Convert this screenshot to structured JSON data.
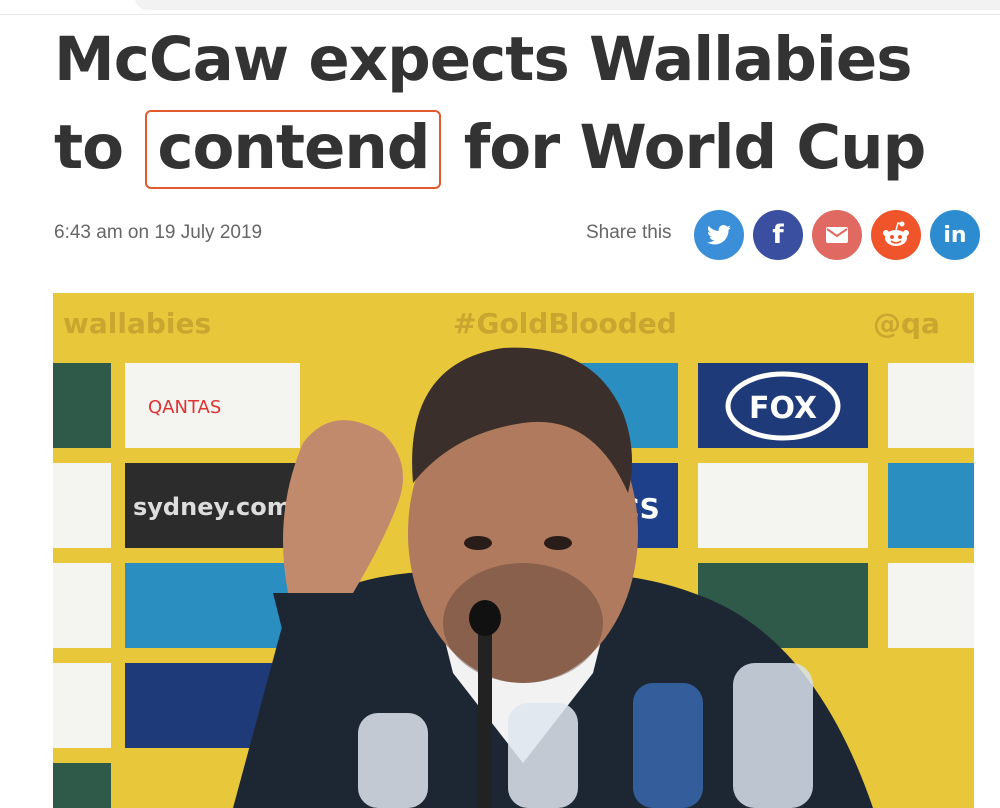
{
  "article": {
    "headline_before": "McCaw expects Wallabies to",
    "headline_highlight": "contend",
    "headline_after": "for World Cup",
    "timestamp": "6:43 am on 19 July 2019"
  },
  "share": {
    "label": "Share this",
    "buttons": [
      {
        "name": "twitter",
        "icon": "twitter-icon",
        "color": "#3b8fd9"
      },
      {
        "name": "facebook",
        "icon": "facebook-icon",
        "color": "#3a4fa0"
      },
      {
        "name": "email",
        "icon": "email-icon",
        "color": "#e06a62"
      },
      {
        "name": "reddit",
        "icon": "reddit-icon",
        "color": "#f0542a"
      },
      {
        "name": "linkedin",
        "icon": "linkedin-icon",
        "color": "#2d8bd0"
      }
    ]
  },
  "photo": {
    "backdrop_texts": [
      "#GoldBlooded",
      "@qa",
      "wallabies"
    ],
    "sponsor_texts": [
      "FOX",
      "sydney.com",
      "SICS",
      "QANTAS"
    ]
  },
  "colors": {
    "highlight_border": "#e05a2b",
    "headline": "#333333",
    "meta": "#666666",
    "backdrop_yellow": "#e8c83a"
  }
}
